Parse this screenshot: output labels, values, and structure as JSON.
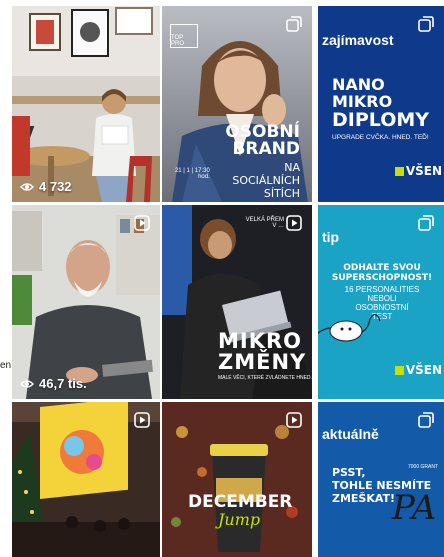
{
  "left_edge_text": "en",
  "tiles": [
    {
      "views": "4 732"
    },
    {
      "brand_logo": "TOP PRO",
      "title_line1": "OSOBNÍ",
      "title_line2": "BRAND",
      "subtitle_line1": "NA SOCIÁLNÍCH",
      "subtitle_line2": "SÍTÍCH",
      "datetime": "21 | 1 | 17:30 hod."
    },
    {
      "header": "zajímavost",
      "line1": "NANO",
      "line2": "MIKRO",
      "line3": "DIPLOMY",
      "sub": "UPGRADE CVČKA. HNED. TEĎ!",
      "brand": "VŠEN"
    },
    {
      "views": "46,7 tis."
    },
    {
      "top_text": "VELKÁ PŘEM",
      "top_text2": "V …",
      "title_line1": "MIKRO",
      "title_line2": "ZMĚNY",
      "sub": "MALÉ VĚCI, KTERÉ ZVLÁDNETE HNED."
    },
    {
      "header": "tip",
      "line1": "ODHALTE SVOU",
      "line2": "SUPERSCHOPNOST!",
      "line3": "16 PERSONALITIES",
      "line4": "NEBOLI",
      "line5": "OSOBNOSTNÍ",
      "line6": "TEST",
      "brand": "VŠEN"
    },
    {},
    {
      "title": "DECEMBER",
      "script": "Jump"
    },
    {
      "header": "aktuálně",
      "line1": "PSST,",
      "line2": "TOHLE NESMÍTE",
      "line3": "ZMEŠKAT!",
      "note": "7000 GRANT",
      "scribble": "PA"
    }
  ],
  "colors": {
    "accent_lime": "#c8e000",
    "blue_tile": "#0f3a8c",
    "teal_tile": "#1aa3c4",
    "blue_tile_b": "#135aa9"
  },
  "icons": {
    "reel": "play-square-icon",
    "carousel": "multi-square-icon",
    "views": "eye-icon"
  }
}
